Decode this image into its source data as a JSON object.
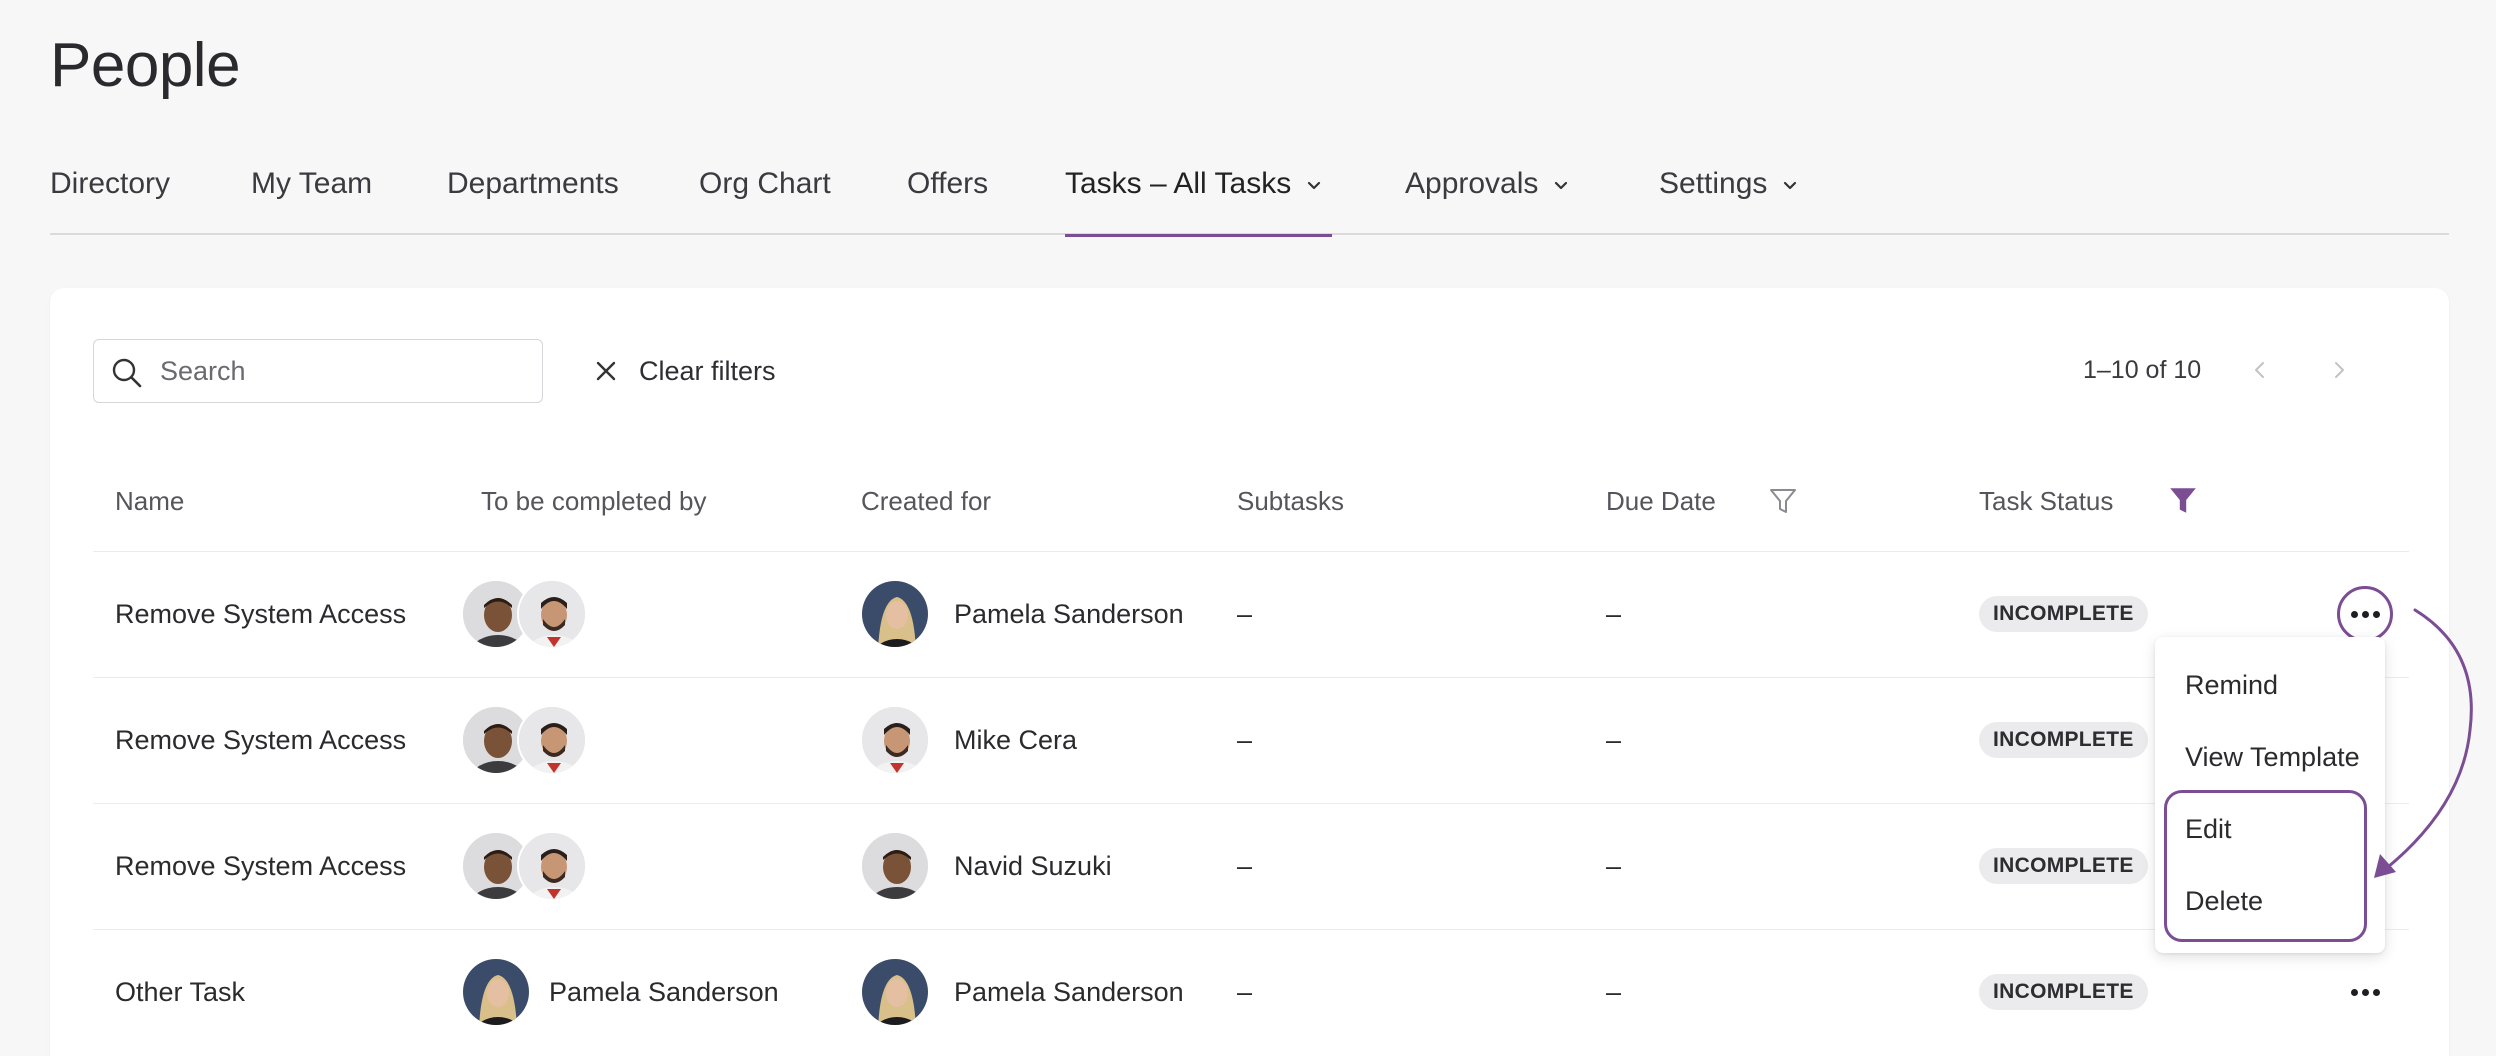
{
  "page": {
    "title": "People"
  },
  "nav": {
    "items": [
      {
        "label": "Directory"
      },
      {
        "label": "My Team"
      },
      {
        "label": "Departments"
      },
      {
        "label": "Org Chart"
      },
      {
        "label": "Offers"
      },
      {
        "label": "Tasks – All Tasks",
        "active": true,
        "dropdown": true
      },
      {
        "label": "Approvals",
        "dropdown": true
      },
      {
        "label": "Settings",
        "dropdown": true
      }
    ]
  },
  "toolbar": {
    "search_placeholder": "Search",
    "clear_filters_label": "Clear filters",
    "pagination_text": "1–10 of 10"
  },
  "table": {
    "columns": {
      "name": "Name",
      "completed_by": "To be completed by",
      "created_for": "Created for",
      "subtasks": "Subtasks",
      "due_date": "Due Date",
      "status": "Task Status"
    },
    "rows": [
      {
        "name": "Remove System Access",
        "completed_by_names": "",
        "created_for": "Pamela Sanderson",
        "subtasks": "–",
        "due_date": "–",
        "status": "INCOMPLETE"
      },
      {
        "name": "Remove System Access",
        "completed_by_names": "",
        "created_for": "Mike Cera",
        "subtasks": "–",
        "due_date": "–",
        "status": "INCOMPLETE"
      },
      {
        "name": "Remove System Access",
        "completed_by_names": "",
        "created_for": "Navid Suzuki",
        "subtasks": "–",
        "due_date": "–",
        "status": "INCOMPLETE"
      },
      {
        "name": "Other Task",
        "completed_by_names": "Pamela Sanderson",
        "created_for": "Pamela Sanderson",
        "subtasks": "–",
        "due_date": "–",
        "status": "INCOMPLETE"
      }
    ]
  },
  "menu": {
    "items": [
      {
        "label": "Remind"
      },
      {
        "label": "View Template"
      },
      {
        "label": "Edit"
      },
      {
        "label": "Delete"
      }
    ]
  },
  "colors": {
    "accent": "#7b4d93",
    "badge_bg": "#ebebee",
    "background": "#f7f7f8"
  }
}
